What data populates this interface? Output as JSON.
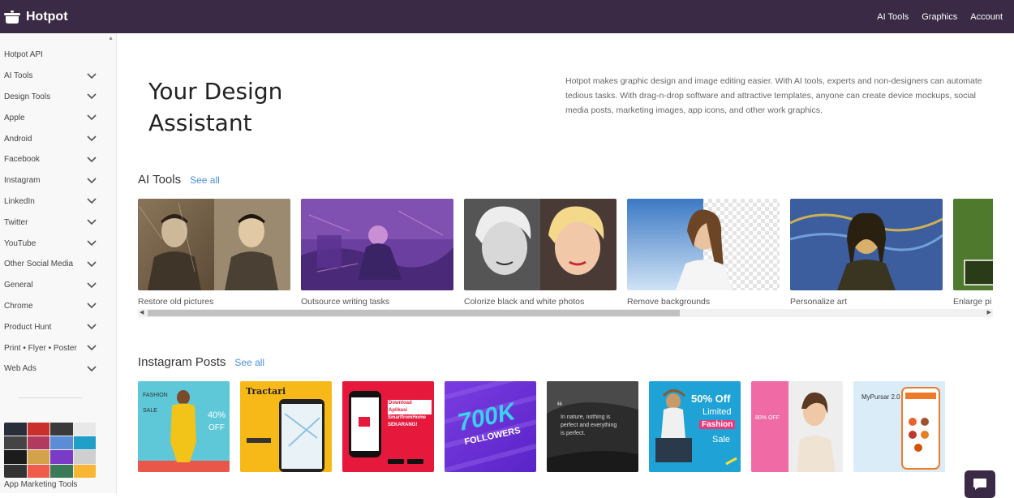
{
  "brand": {
    "name": "Hotpot"
  },
  "topnav": [
    "AI Tools",
    "Graphics",
    "Account"
  ],
  "sidebar": {
    "api_label": "Hotpot API",
    "items": [
      "AI Tools",
      "Design Tools",
      "Apple",
      "Android",
      "Facebook",
      "Instagram",
      "LinkedIn",
      "Twitter",
      "YouTube",
      "Other Social Media",
      "General",
      "Chrome",
      "Product Hunt",
      "Print • Flyer • Poster",
      "Web Ads"
    ],
    "thumb_label": "App Marketing Tools"
  },
  "hero": {
    "title": "Your Design Assistant",
    "description": "Hotpot makes graphic design and image editing easier. With AI tools, experts and non-designers can automate tedious tasks. With drag-n-drop software and attractive templates, anyone can create device mockups, social media posts, marketing images, app icons, and other work graphics."
  },
  "ai_tools": {
    "heading": "AI Tools",
    "see_all": "See all",
    "cards": [
      {
        "label": "Restore old pictures",
        "icon": "restore-photo"
      },
      {
        "label": "Outsource writing tasks",
        "icon": "writing-art"
      },
      {
        "label": "Colorize black and white photos",
        "icon": "colorize"
      },
      {
        "label": "Remove backgrounds",
        "icon": "remove-bg"
      },
      {
        "label": "Personalize art",
        "icon": "art"
      },
      {
        "label": "Enlarge pi",
        "icon": "enlarge"
      }
    ]
  },
  "instagram": {
    "heading": "Instagram Posts",
    "see_all": "See all",
    "posts": [
      {
        "lines": [
          "FASHION",
          "SALE",
          "40%",
          "OFF"
        ]
      },
      {
        "lines": [
          "Tractari"
        ]
      },
      {
        "lines": [
          "Download Aplikasi",
          "SmartfromHome",
          "SEKARANG!"
        ]
      },
      {
        "lines": [
          "700K",
          "FOLLOWERS"
        ]
      },
      {
        "lines": [
          "In nature, nothing is",
          "perfect and everything",
          "is perfect."
        ]
      },
      {
        "lines": [
          "50% Off",
          "Limited",
          "Fashion",
          "Sale"
        ]
      },
      {
        "lines": [
          "80% OFF"
        ]
      },
      {
        "lines": [
          "MyPursar 2.0"
        ]
      }
    ]
  },
  "colors": {
    "topbar": "#3b2a45",
    "link": "#4a90d9"
  }
}
